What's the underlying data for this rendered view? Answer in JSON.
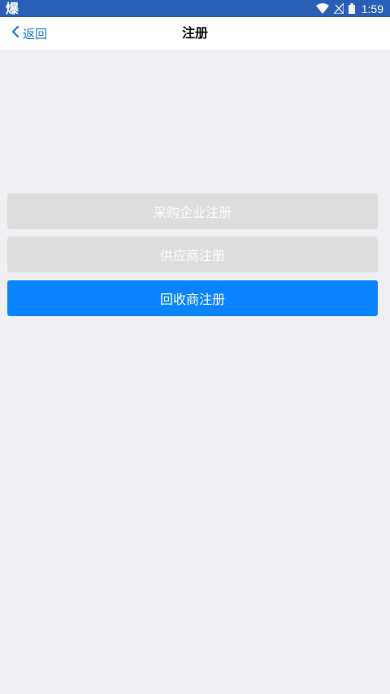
{
  "status_bar": {
    "app_icon_text": "爆",
    "time": "1:59",
    "icons": [
      "wifi-icon",
      "signal-off-icon",
      "battery-icon"
    ]
  },
  "nav": {
    "back_label": "返回",
    "title": "注册"
  },
  "buttons": {
    "purchase_enterprise": "采购企业注册",
    "supplier": "供应商注册",
    "recycler": "回收商注册"
  },
  "colors": {
    "status_bar": "#2a5fb8",
    "accent": "#0a84ff",
    "back_link": "#1c7cd6",
    "disabled_button": "#dcdcdc",
    "page_background": "#efeff4"
  }
}
